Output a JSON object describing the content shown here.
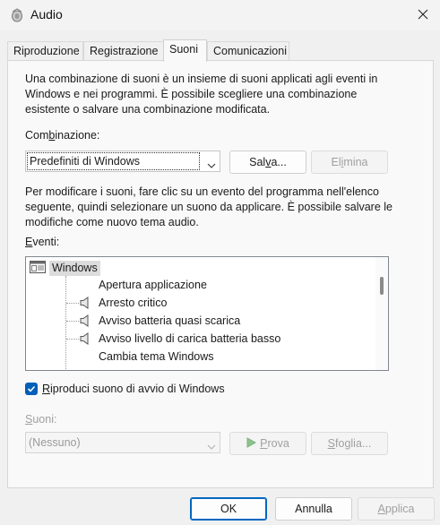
{
  "window": {
    "title": "Audio",
    "icon": "speaker-icon",
    "close_icon": "close-icon"
  },
  "tabs": [
    {
      "label": "Riproduzione"
    },
    {
      "label": "Registrazione"
    },
    {
      "label": "Suoni",
      "active": true
    },
    {
      "label": "Comunicazioni"
    }
  ],
  "panel": {
    "intro_text": "Una combinazione di suoni è un insieme di suoni applicati agli eventi in Windows e nei programmi. È possibile scegliere una combinazione esistente o salvare una combinazione modificata.",
    "scheme_label_pre": "Com",
    "scheme_label_ul": "b",
    "scheme_label_post": "inazione:",
    "scheme_value": "Predefiniti di Windows",
    "save_label_pre": "Sal",
    "save_label_ul": "v",
    "save_label_post": "a...",
    "delete_label_pre": "El",
    "delete_label_ul": "i",
    "delete_label_post": "mina",
    "help_text": "Per modificare i suoni, fare clic su un evento del programma nell'elenco seguente, quindi selezionare un suono da applicare. È possibile salvare le modifiche come nuovo tema audio.",
    "events_label_ul": "E",
    "events_label_post": "venti:",
    "events_root": "Windows",
    "events": [
      {
        "label": "Apertura applicazione",
        "has_sound": false
      },
      {
        "label": "Arresto critico",
        "has_sound": true
      },
      {
        "label": "Avviso batteria quasi scarica",
        "has_sound": true
      },
      {
        "label": "Avviso livello di carica batteria basso",
        "has_sound": true
      },
      {
        "label": "Cambia tema Windows",
        "has_sound": false
      }
    ],
    "startup_sound_ul": "R",
    "startup_sound_post": "iproduci suono di avvio di Windows",
    "startup_sound_checked": true,
    "sounds_label_ul": "S",
    "sounds_label_post": "uoni:",
    "sound_value": "(Nessuno)",
    "test_label_ul": "P",
    "test_label_post": "rova",
    "browse_label_ul": "S",
    "browse_label_post": "foglia..."
  },
  "footer": {
    "ok_label": "OK",
    "cancel_label": "Annulla",
    "apply_label_ul": "A",
    "apply_label_post": "pplica"
  },
  "colors": {
    "accent": "#005fb8",
    "primary_border": "#0067c0",
    "disabled_text": "#a0a0a0"
  }
}
